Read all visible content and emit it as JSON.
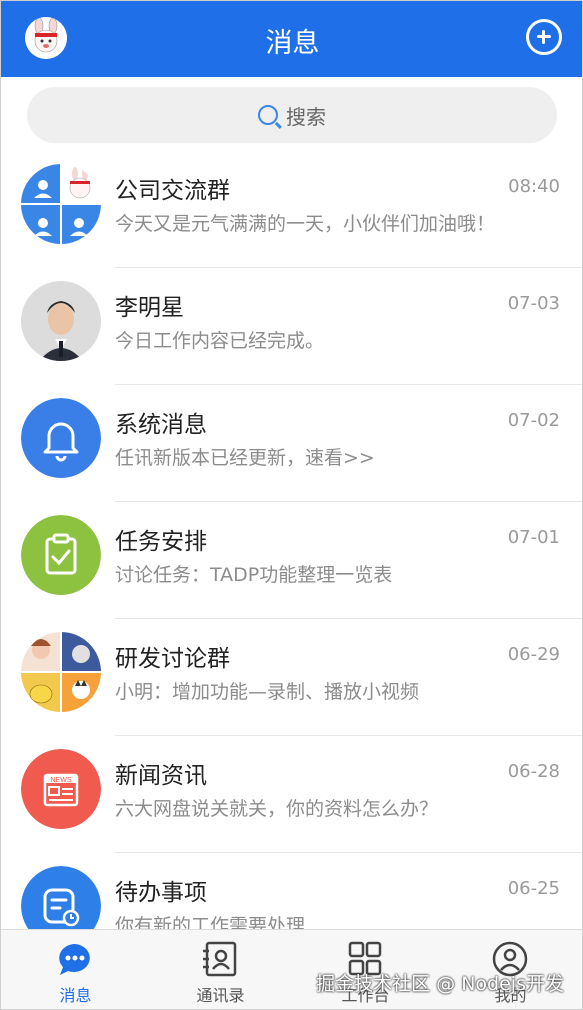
{
  "header": {
    "title": "消息"
  },
  "search": {
    "label": "搜索"
  },
  "conversations": [
    {
      "name": "公司交流群",
      "time": "08:40",
      "message": "今天又是元气满满的一天，小伙伴们加油哦！",
      "avatar": "group-avatar"
    },
    {
      "name": "李明星",
      "time": "07-03",
      "message": "今日工作内容已经完成。",
      "avatar": "person-avatar"
    },
    {
      "name": "系统消息",
      "time": "07-02",
      "message": "任讯新版本已经更新，速看>>",
      "avatar": "bell-icon",
      "color": "#3a7ee8"
    },
    {
      "name": "任务安排",
      "time": "07-01",
      "message": "讨论任务：TADP功能整理一览表",
      "avatar": "clipboard-icon",
      "color": "#8cc23f"
    },
    {
      "name": "研发讨论群",
      "time": "06-29",
      "message": "小明：增加功能—录制、播放小视频",
      "avatar": "group-avatar"
    },
    {
      "name": "新闻资讯",
      "time": "06-28",
      "message": "六大网盘说关就关，你的资料怎么办？",
      "avatar": "news-icon",
      "color": "#f05a4f"
    },
    {
      "name": "待办事项",
      "time": "06-25",
      "message": "你有新的工作需要处理",
      "avatar": "todo-icon",
      "color": "#2f7fe8"
    }
  ],
  "tabs": [
    {
      "label": "消息",
      "icon": "chat-icon",
      "active": true
    },
    {
      "label": "通讯录",
      "icon": "contacts-icon",
      "active": false
    },
    {
      "label": "工作台",
      "icon": "grid-icon",
      "active": false
    },
    {
      "label": "我的",
      "icon": "user-icon",
      "active": false
    }
  ],
  "watermark": "掘金技术社区 @ Nodejs开发",
  "colors": {
    "primary": "#1f6fe8",
    "text": "#222222",
    "muted": "#8c8c8c"
  }
}
